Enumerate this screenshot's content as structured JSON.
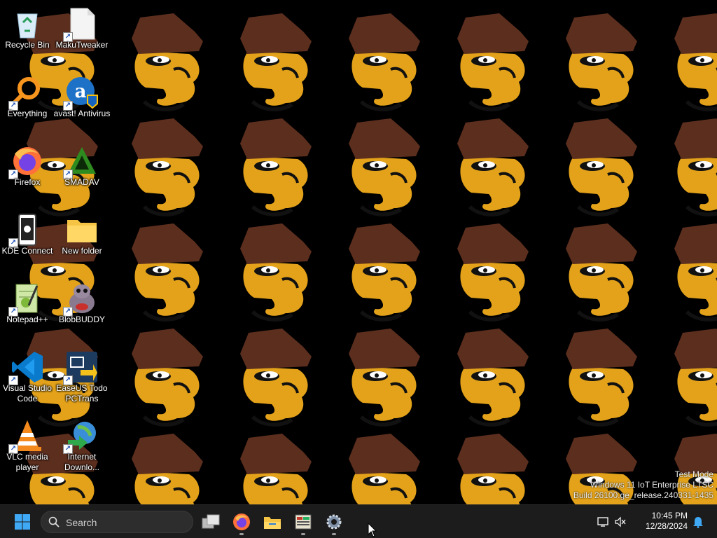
{
  "desktop": {
    "icons": [
      {
        "id": "recycle-bin",
        "label": "Recycle Bin",
        "shortcut": false
      },
      {
        "id": "makutweaker",
        "label": "MakuTweaker",
        "shortcut": true
      },
      {
        "id": "everything",
        "label": "Everything",
        "shortcut": true
      },
      {
        "id": "avast",
        "label": "avast! Antivirus",
        "shortcut": true
      },
      {
        "id": "firefox",
        "label": "Firefox",
        "shortcut": true
      },
      {
        "id": "smadav",
        "label": "SMADAV",
        "shortcut": true
      },
      {
        "id": "kde-connect",
        "label": "KDE Connect",
        "shortcut": true
      },
      {
        "id": "new-folder",
        "label": "New folder",
        "shortcut": false
      },
      {
        "id": "notepadpp",
        "label": "Notepad++",
        "shortcut": true
      },
      {
        "id": "blobbuddy",
        "label": "BlobBUDDY",
        "shortcut": true
      },
      {
        "id": "vscode",
        "label": "Visual Studio Code",
        "shortcut": true
      },
      {
        "id": "easeus",
        "label": "EaseUS Todo PCTrans",
        "shortcut": true
      },
      {
        "id": "vlc",
        "label": "VLC media player",
        "shortcut": true
      },
      {
        "id": "idm",
        "label": "Internet Downlo...",
        "shortcut": true
      }
    ],
    "watermark": {
      "line1": "Test Mode",
      "line2": "Windows 11 IoT Enterprise LTSC",
      "line3": "Build 26100.ge_release.240331-1435"
    }
  },
  "taskbar": {
    "search_placeholder": "Search",
    "pinned": [
      "start-icon",
      "task-view-icon",
      "firefox-icon",
      "file-explorer-icon",
      "spreadsheet-app-icon",
      "settings-icon"
    ],
    "clock": {
      "time": "10:45 PM",
      "date": "12/28/2024"
    }
  },
  "colors": {
    "taskbar": "#1c1c1c",
    "wallpaper_bg": "#000000",
    "hat": "#5c2e1e",
    "face": "#e3a21a"
  }
}
